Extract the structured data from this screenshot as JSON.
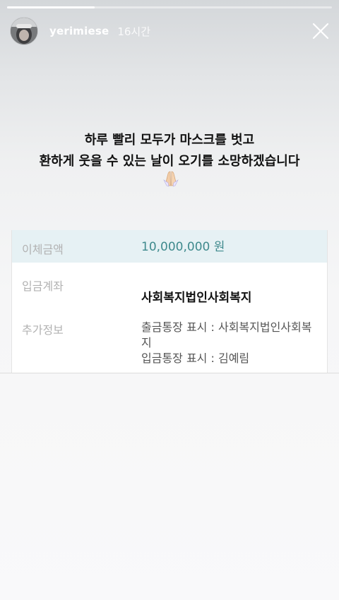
{
  "story": {
    "progress": 0.27,
    "username": "yerimiese",
    "time": "16시간",
    "icons": {
      "close": "close-icon",
      "avatar": "avatar-photo",
      "emoji": "folded-hands-emoji"
    }
  },
  "caption": {
    "line1": "하루 빨리 모두가 마스크를 벗고",
    "line2": "환하게 웃을 수 있는 날이 오기를 소망하겠습니다"
  },
  "transfer": {
    "amount_label": "이체금액",
    "amount_value": "10,000,000 원",
    "account_label": "입금계좌",
    "account_value": "사회복지법인사회복지",
    "info_label": "추가정보",
    "info_line1": "출금통장 표시 : 사회복지법인사회복지",
    "info_line2": "입금통장 표시 : 김예림"
  },
  "colors": {
    "amount": "#3f8a8d",
    "highlight_row": "#e6f1f4"
  }
}
